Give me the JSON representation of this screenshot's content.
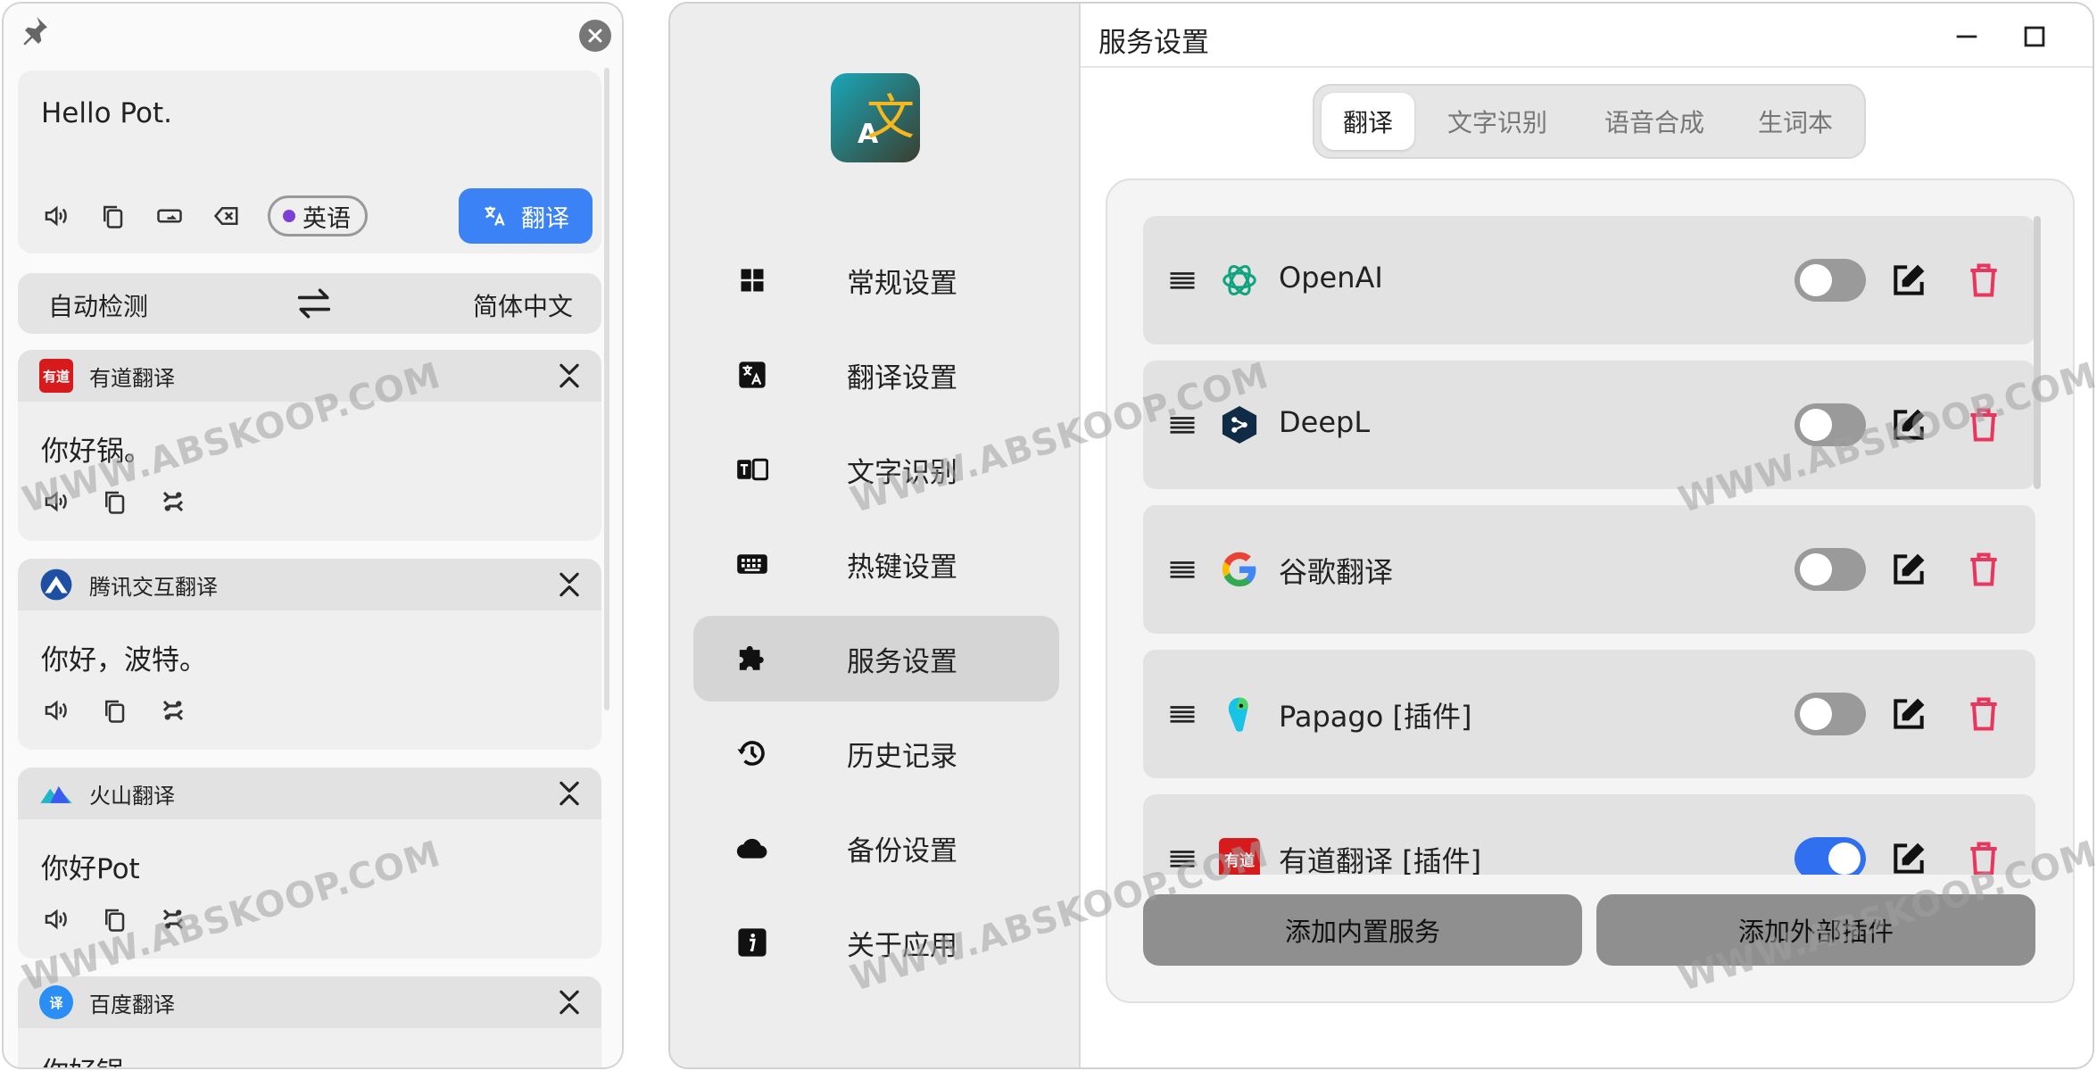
{
  "popup": {
    "input": {
      "text": "Hello Pot.",
      "language_chip": "英语",
      "translate_button": "翻译"
    },
    "language_bar": {
      "source": "自动检测",
      "target": "简体中文"
    },
    "results": [
      {
        "service": "有道翻译",
        "logo_text": "有道",
        "text": "你好锅。"
      },
      {
        "service": "腾讯交互翻译",
        "text": "你好，波特。"
      },
      {
        "service": "火山翻译",
        "text": "你好Pot"
      },
      {
        "service": "百度翻译",
        "logo_text": "译",
        "text": "你好锅"
      }
    ]
  },
  "config": {
    "window_title": "服务设置",
    "sidebar": {
      "logo_text": "文",
      "items": [
        {
          "label": "常规设置",
          "icon": "grid-icon"
        },
        {
          "label": "翻译设置",
          "icon": "translate-icon"
        },
        {
          "label": "文字识别",
          "icon": "ocr-icon"
        },
        {
          "label": "热键设置",
          "icon": "keyboard-icon"
        },
        {
          "label": "服务设置",
          "icon": "puzzle-icon",
          "active": true
        },
        {
          "label": "历史记录",
          "icon": "history-icon"
        },
        {
          "label": "备份设置",
          "icon": "cloud-icon"
        },
        {
          "label": "关于应用",
          "icon": "info-icon"
        }
      ]
    },
    "tabs": [
      {
        "label": "翻译",
        "active": true
      },
      {
        "label": "文字识别"
      },
      {
        "label": "语音合成"
      },
      {
        "label": "生词本"
      }
    ],
    "services": [
      {
        "name": "OpenAI",
        "enabled": false
      },
      {
        "name": "DeepL",
        "enabled": false
      },
      {
        "name": "谷歌翻译",
        "enabled": false
      },
      {
        "name": "Papago [插件]",
        "enabled": false
      },
      {
        "name": "有道翻译 [插件]",
        "logo_text": "有道",
        "enabled": true
      }
    ],
    "buttons": {
      "add_builtin": "添加内置服务",
      "add_external": "添加外部插件"
    }
  },
  "watermark": "WWW.ABSKOOP.COM",
  "colors": {
    "accent": "#3b82f6",
    "toggle_on": "#2f6ff0",
    "delete": "#e8365f",
    "youdao": "#d71a1b"
  }
}
